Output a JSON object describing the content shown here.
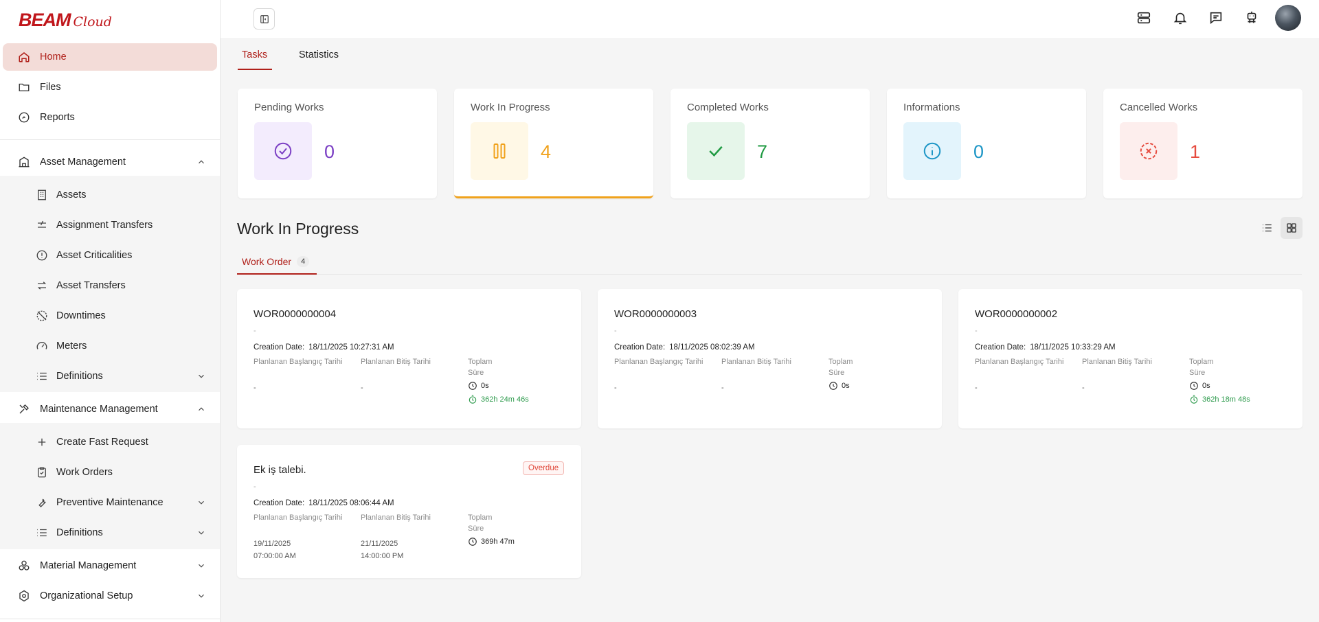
{
  "brand": {
    "name": "BEAM",
    "suffix": "Cloud"
  },
  "sidebar": {
    "items": [
      {
        "label": "Home",
        "icon": "home-icon"
      },
      {
        "label": "Files",
        "icon": "folder-icon"
      },
      {
        "label": "Reports",
        "icon": "reports-icon"
      }
    ],
    "asset_management": {
      "label": "Asset Management",
      "items": [
        {
          "label": "Assets"
        },
        {
          "label": "Assignment Transfers"
        },
        {
          "label": "Asset Criticalities"
        },
        {
          "label": "Asset Transfers"
        },
        {
          "label": "Downtimes"
        },
        {
          "label": "Meters"
        },
        {
          "label": "Definitions"
        }
      ]
    },
    "maintenance_management": {
      "label": "Maintenance Management",
      "items": [
        {
          "label": "Create Fast Request"
        },
        {
          "label": "Work Orders"
        },
        {
          "label": "Preventive Maintenance"
        },
        {
          "label": "Definitions"
        }
      ]
    },
    "material_management": {
      "label": "Material Management"
    },
    "organizational_setup": {
      "label": "Organizational Setup"
    }
  },
  "tabs": [
    {
      "label": "Tasks",
      "active": true
    },
    {
      "label": "Statistics",
      "active": false
    }
  ],
  "stats": [
    {
      "title": "Pending Works",
      "value": "0",
      "color": "#7b3fc4",
      "bg": "#f3ecfd"
    },
    {
      "title": "Work In Progress",
      "value": "4",
      "color": "#f0a21c",
      "bg": "#fff8e6"
    },
    {
      "title": "Completed Works",
      "value": "7",
      "color": "#1f9a42",
      "bg": "#e6f6ea"
    },
    {
      "title": "Informations",
      "value": "0",
      "color": "#1d96c6",
      "bg": "#e3f4fc"
    },
    {
      "title": "Cancelled Works",
      "value": "1",
      "color": "#e64b3f",
      "bg": "#fdeeed"
    }
  ],
  "section": {
    "title": "Work In Progress",
    "subtab_label": "Work Order",
    "subtab_count": "4"
  },
  "labels": {
    "creation_date": "Creation Date:",
    "planned_start": "Planlanan Başlangıç Tarihi",
    "planned_end": "Planlanan Bitiş Tarihi",
    "total": "Toplam Süre",
    "placeholder": "-",
    "overdue": "Overdue"
  },
  "work_cards": [
    {
      "title": "WOR0000000004",
      "creation": "18/11/2025 10:27:31 AM",
      "start": "-",
      "end": "-",
      "time1": "0s",
      "time2": "362h 24m 46s"
    },
    {
      "title": "WOR0000000003",
      "creation": "18/11/2025 08:02:39 AM",
      "start": "-",
      "end": "-",
      "time1": "0s",
      "time2": ""
    },
    {
      "title": "WOR0000000002",
      "creation": "18/11/2025 10:33:29 AM",
      "start": "-",
      "end": "-",
      "time1": "0s",
      "time2": "362h 18m 48s"
    },
    {
      "title": "Ek iş talebi.",
      "creation": "18/11/2025 08:06:44 AM",
      "start_date": "19/11/2025",
      "start_time": "07:00:00 AM",
      "end_date": "21/11/2025",
      "end_time": "14:00:00 PM",
      "time1": "369h 47m",
      "overdue": true
    }
  ]
}
